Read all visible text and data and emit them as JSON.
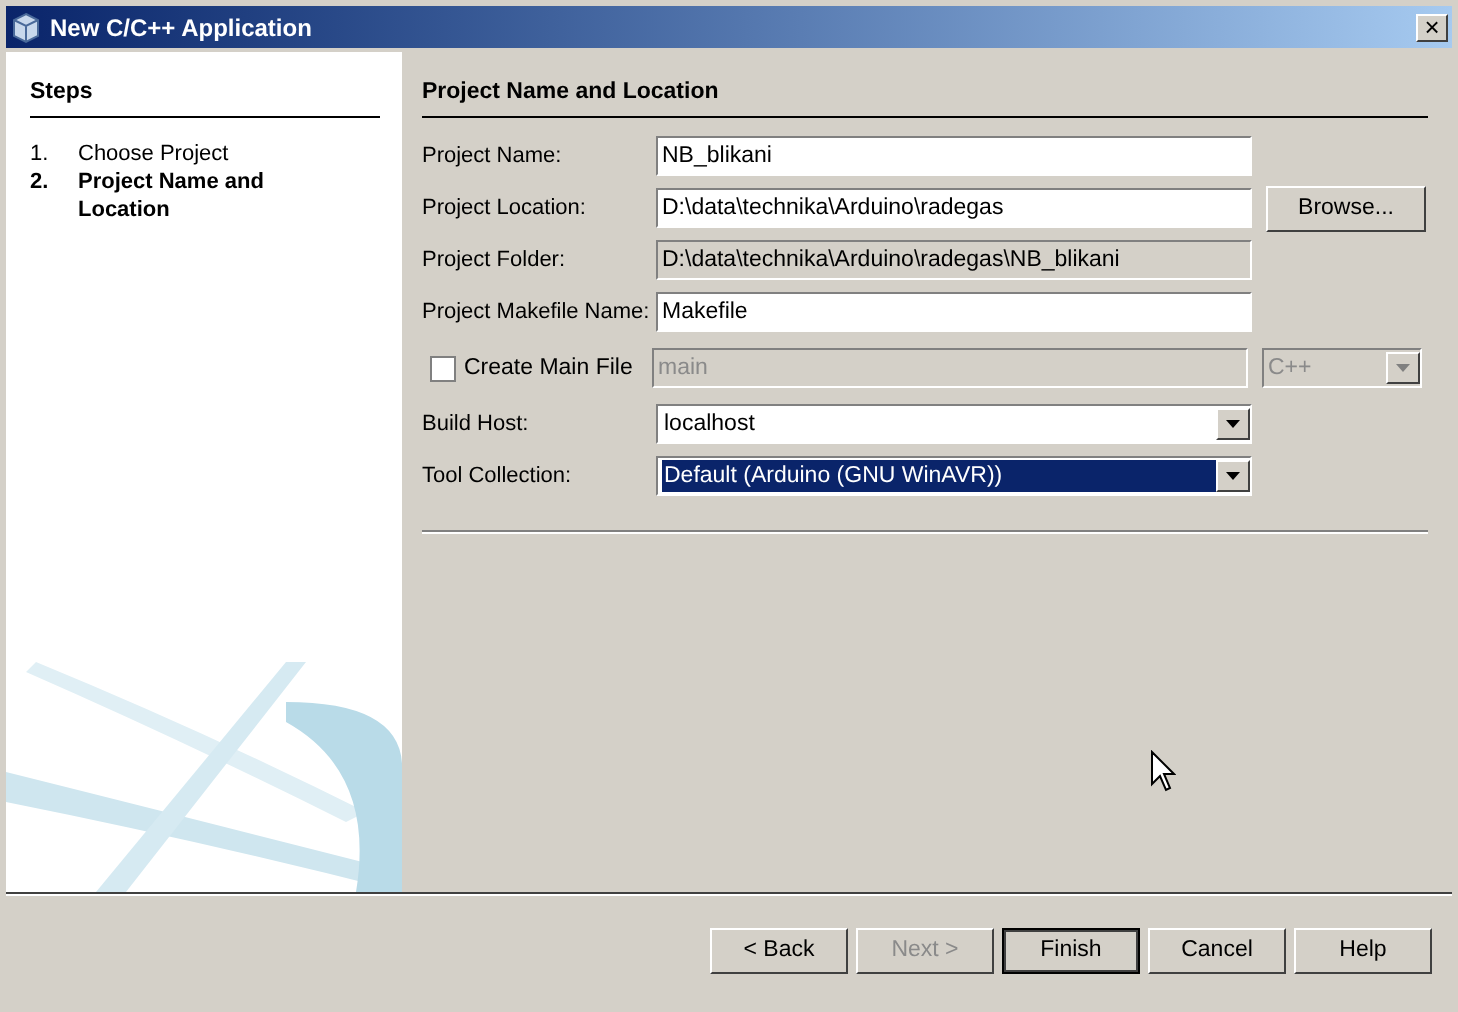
{
  "window": {
    "title": "New C/C++ Application",
    "close": "×"
  },
  "steps": {
    "title": "Steps",
    "items": [
      {
        "number": "1.",
        "label": "Choose Project",
        "selected": false
      },
      {
        "number": "2.",
        "label": "Project Name and Location",
        "selected": true
      }
    ]
  },
  "panel": {
    "title": "Project Name and Location",
    "rows": [
      {
        "kind": "text",
        "label": "Project Name:",
        "value": "NB_blikani"
      },
      {
        "kind": "text",
        "label": "Project Location:",
        "value": "D:\\data\\technika\\Arduino\\radegas",
        "button": "Browse..."
      },
      {
        "kind": "readonly",
        "label": "Project Folder:",
        "value": "D:\\data\\technika\\Arduino\\radegas\\NB_blikani"
      },
      {
        "kind": "text",
        "label": "Project Makefile Name:",
        "value": "Makefile"
      },
      {
        "kind": "checkbox",
        "label": "Create Main File",
        "checked": false,
        "value": "main",
        "option": "C++"
      },
      {
        "kind": "combo",
        "label": "Build Host:",
        "value": "localhost",
        "highlighted": false
      },
      {
        "kind": "combo",
        "label": "Tool Collection:",
        "value": "Default (Arduino (GNU WinAVR))",
        "highlighted": true
      }
    ]
  },
  "buttons": [
    {
      "label": "< Back",
      "disabled": false,
      "default": false
    },
    {
      "label": "Next >",
      "disabled": true,
      "default": false
    },
    {
      "label": "Finish",
      "disabled": false,
      "default": true
    },
    {
      "label": "Cancel",
      "disabled": false,
      "default": false
    },
    {
      "label": "Help",
      "disabled": false,
      "default": false
    }
  ]
}
